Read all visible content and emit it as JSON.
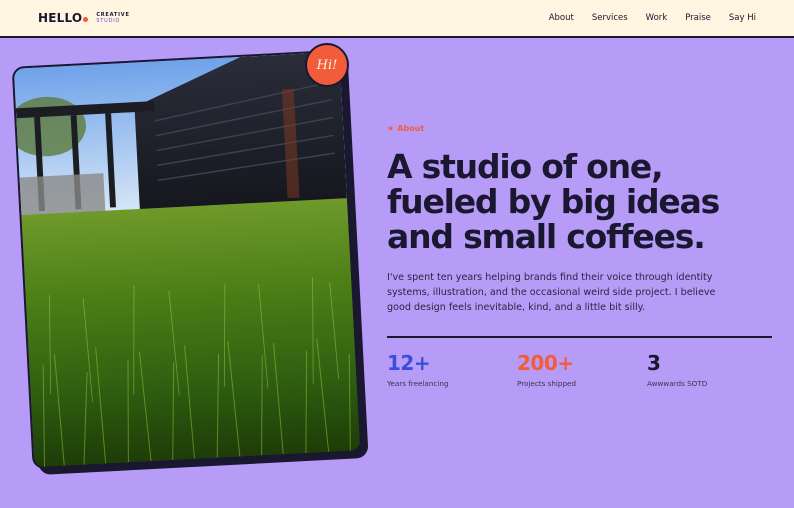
{
  "nav": {
    "brand": "HELLO",
    "brand_sub_1": "CREATIVE",
    "brand_sub_2": "STUDIO",
    "links": [
      "About",
      "Services",
      "Work",
      "Praise",
      "Say Hi"
    ]
  },
  "badge": {
    "text": "Hi!"
  },
  "hero": {
    "eyebrow": "About",
    "eyebrow_icon": "star-icon",
    "headline": "A studio of one, fueled by big ideas and small coffees.",
    "lede": "I've spent ten years helping brands find their voice through identity systems, illustration, and the occasional weird side project. I believe good design feels inevitable, kind, and a little bit silly."
  },
  "stats": [
    {
      "value": "12+",
      "label": "Years freelancing",
      "color": "#3A4FD8"
    },
    {
      "value": "200+",
      "label": "Projects shipped",
      "color": "#F25C3B"
    },
    {
      "value": "3",
      "label": "Awwwards SOTD",
      "color": "#1a1730"
    }
  ],
  "colors": {
    "background": "#B69CF7",
    "nav_bg": "#FFF5E1",
    "accent": "#F25C3B",
    "ink": "#1a1730"
  }
}
